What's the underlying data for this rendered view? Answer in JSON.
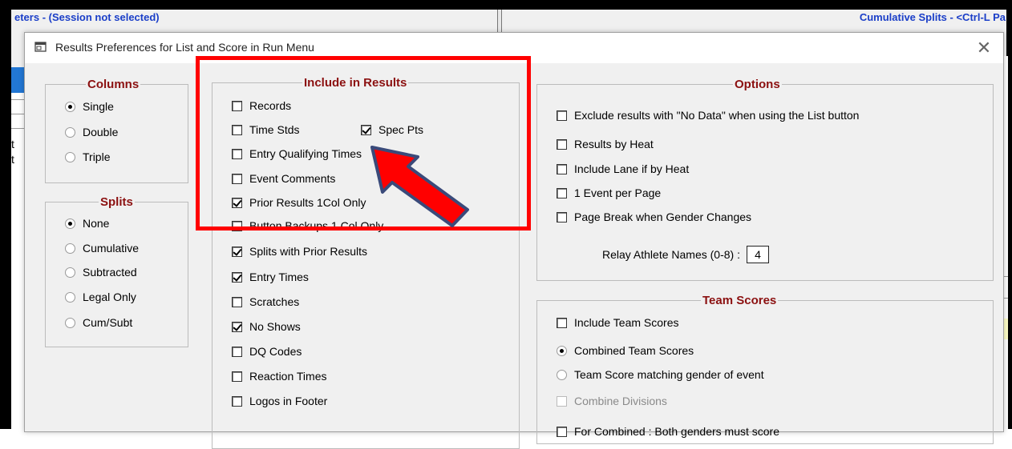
{
  "background": {
    "header_left": "eters - (Session not selected)",
    "header_right": "Cumulative Splits - <Ctrl-L Pa",
    "left_fragments": [
      "t",
      "t"
    ]
  },
  "dialog": {
    "title": "Results Preferences for List and Score in Run Menu",
    "close_symbol": "✕"
  },
  "columns": {
    "title": "Columns",
    "options": [
      {
        "label": "Single",
        "checked": true
      },
      {
        "label": "Double",
        "checked": false
      },
      {
        "label": "Triple",
        "checked": false
      }
    ]
  },
  "splits": {
    "title": "Splits",
    "options": [
      {
        "label": "None",
        "checked": true
      },
      {
        "label": "Cumulative",
        "checked": false
      },
      {
        "label": "Subtracted",
        "checked": false
      },
      {
        "label": "Legal Only",
        "checked": false
      },
      {
        "label": "Cum/Subt",
        "checked": false
      }
    ]
  },
  "include": {
    "title": "Include in Results",
    "items": [
      {
        "label": "Records",
        "checked": false
      },
      {
        "label": "Time Stds",
        "checked": false
      },
      {
        "label": "Spec Pts",
        "checked": true
      },
      {
        "label": "Entry Qualifying Times",
        "checked": false
      },
      {
        "label": "Event Comments",
        "checked": false
      },
      {
        "label": "Prior Results 1Col Only",
        "checked": true
      },
      {
        "label": "Button Backups 1 Col Only",
        "checked": false
      },
      {
        "label": "Splits with Prior Results",
        "checked": true
      },
      {
        "label": "Entry Times",
        "checked": true
      },
      {
        "label": "Scratches",
        "checked": false
      },
      {
        "label": "No Shows",
        "checked": true
      },
      {
        "label": "DQ Codes",
        "checked": false
      },
      {
        "label": "Reaction Times",
        "checked": false
      },
      {
        "label": "Logos in Footer",
        "checked": false
      }
    ]
  },
  "options": {
    "title": "Options",
    "items": [
      {
        "label": "Exclude results with \"No Data\" when using the List button",
        "checked": false
      },
      {
        "label": "Results by Heat",
        "checked": false
      },
      {
        "label": "Include Lane if by Heat",
        "checked": false
      },
      {
        "label": "1 Event per Page",
        "checked": false
      },
      {
        "label": "Page Break when Gender Changes",
        "checked": false
      }
    ],
    "relay_label": "Relay Athlete Names (0-8) :",
    "relay_value": "4"
  },
  "team_scores": {
    "title": "Team Scores",
    "include_label": "Include Team Scores",
    "combined_label": "Combined Team Scores",
    "matching_label": "Team Score matching gender of event",
    "combine_divisions_label": "Combine Divisions",
    "both_genders_label": "For Combined : Both genders must score"
  },
  "annotation": {
    "highlight_color": "#ff0000",
    "arrow_fill": "#ff0000",
    "arrow_outline": "#3a4a7a"
  }
}
